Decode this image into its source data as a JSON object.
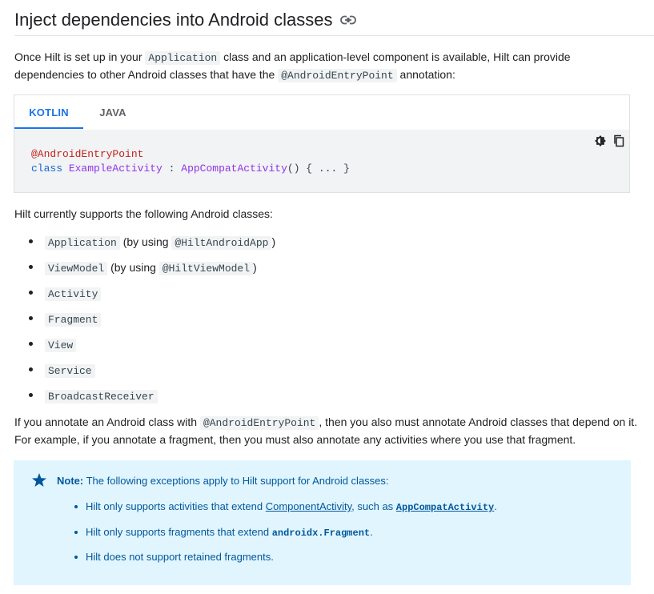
{
  "heading": {
    "title": "Inject dependencies into Android classes",
    "link_icon": "link-icon"
  },
  "intro": {
    "t1": "Once Hilt is set up in your ",
    "c1": "Application",
    "t2": " class and an application-level component is available, Hilt can provide dependencies to other Android classes that have the ",
    "c2": "@AndroidEntryPoint",
    "t3": " annotation:"
  },
  "tabs": [
    "KOTLIN",
    "JAVA"
  ],
  "code": {
    "line1": "@AndroidEntryPoint",
    "line2_kw": "class",
    "line2_name": "ExampleActivity",
    "line2_sep": " : ",
    "line2_super": "AppCompatActivity",
    "line2_rest": "() { ... }",
    "icons": [
      "dark-mode-icon",
      "copy-icon"
    ]
  },
  "supports_intro": "Hilt currently supports the following Android classes:",
  "classes": [
    {
      "code": "Application",
      "t1": " (by using ",
      "code2": "@HiltAndroidApp",
      "t2": ")"
    },
    {
      "code": "ViewModel",
      "t1": " (by using ",
      "code2": "@HiltViewModel",
      "t2": ")"
    },
    {
      "code": "Activity"
    },
    {
      "code": "Fragment"
    },
    {
      "code": "View"
    },
    {
      "code": "Service"
    },
    {
      "code": "BroadcastReceiver"
    }
  ],
  "annotate": {
    "t1": "If you annotate an Android class with ",
    "c1": "@AndroidEntryPoint",
    "t2": ", then you also must annotate Android classes that depend on it. For example, if you annotate a fragment, then you must also annotate any activities where you use that fragment."
  },
  "note": {
    "label": "Note:",
    "text": " The following exceptions apply to Hilt support for Android classes:",
    "b1_t1": "Hilt only supports activities that extend ",
    "b1_l1": "ComponentActivity",
    "b1_t2": ", such as ",
    "b1_l2": "AppCompatActivity",
    "b1_t3": ".",
    "b2_t1": "Hilt only supports fragments that extend ",
    "b2_c1": "androidx.Fragment",
    "b2_t2": ".",
    "b3": "Hilt does not support retained fragments.",
    "colors": {
      "background": "#e1f5fe",
      "text": "#01579b"
    }
  },
  "colors": {
    "accent": "#1a73e8",
    "code_bg": "#f1f3f4"
  }
}
